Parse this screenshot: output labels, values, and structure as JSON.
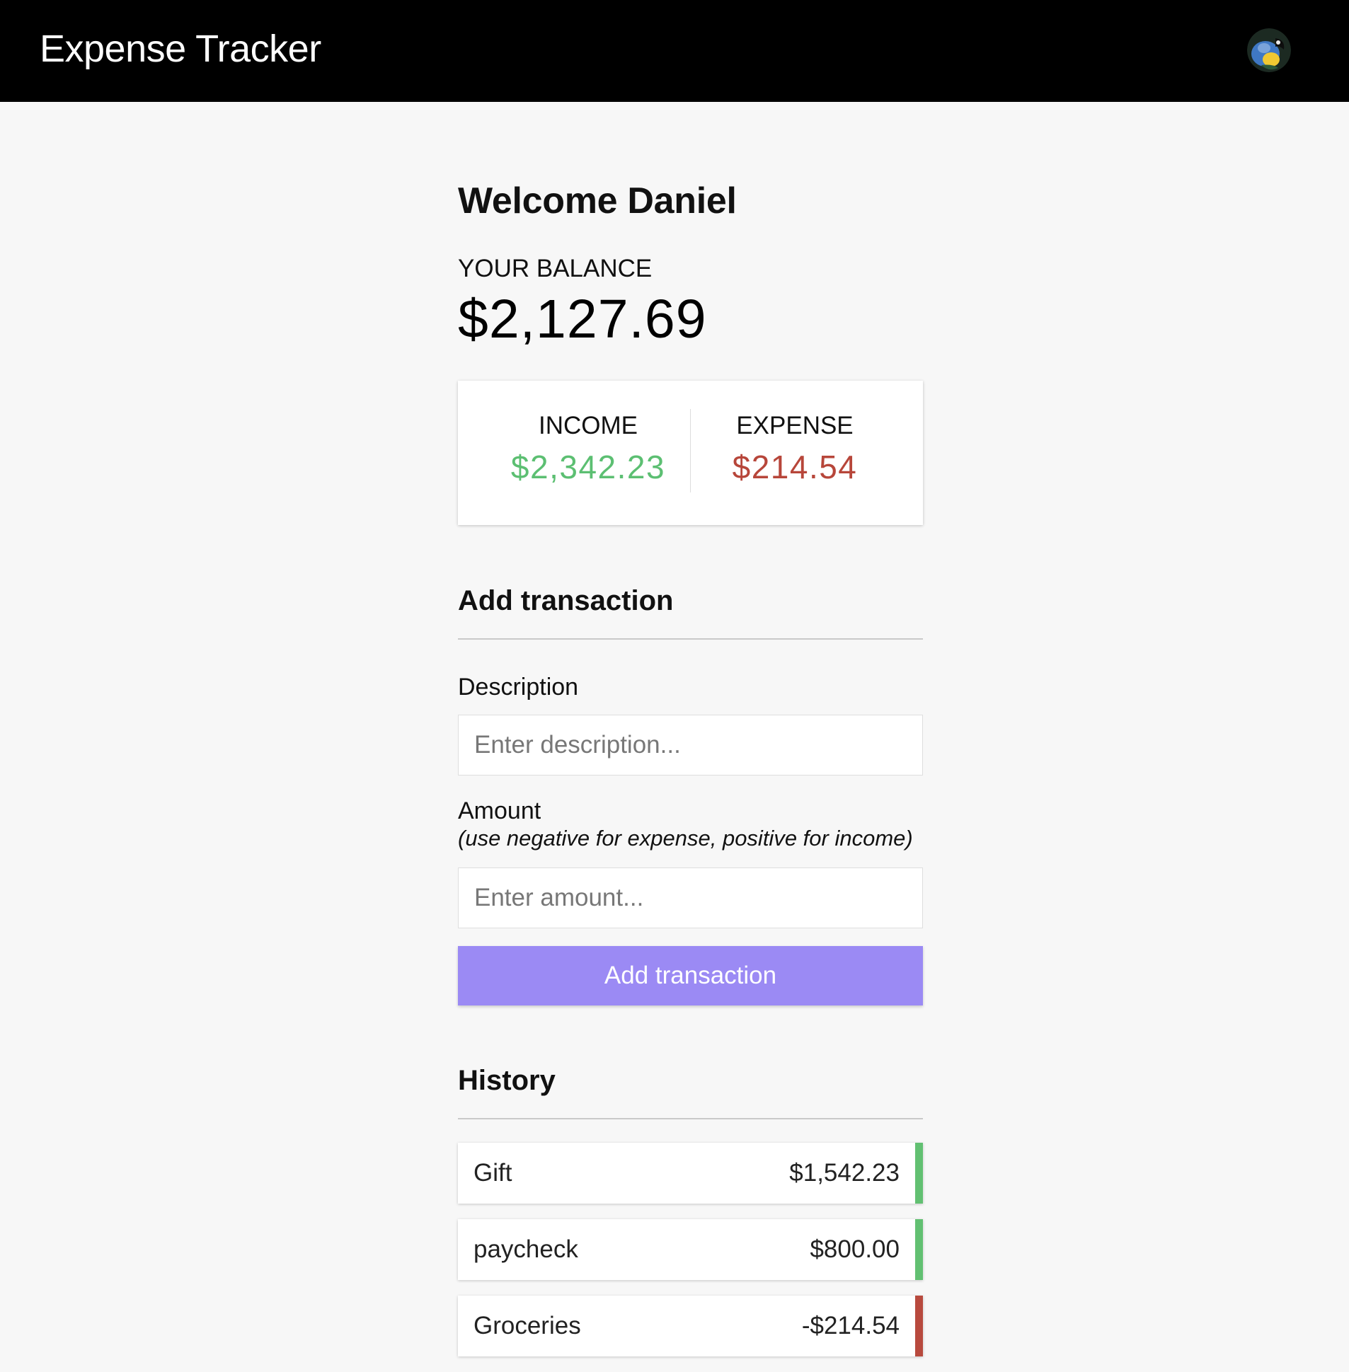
{
  "header": {
    "title": "Expense Tracker",
    "avatar_icon": "parrot-avatar-icon"
  },
  "welcome": "Welcome Daniel",
  "balance": {
    "label": "YOUR BALANCE",
    "value": "$2,127.69"
  },
  "summary": {
    "income_label": "INCOME",
    "income_value": "$2,342.23",
    "expense_label": "EXPENSE",
    "expense_value": "$214.54"
  },
  "add_transaction": {
    "title": "Add transaction",
    "description_label": "Description",
    "description_placeholder": "Enter description...",
    "description_value": "",
    "amount_label": "Amount",
    "amount_hint": "(use negative for expense, positive for income)",
    "amount_placeholder": "Enter amount...",
    "amount_value": "",
    "button_label": "Add transaction"
  },
  "history": {
    "title": "History",
    "items": [
      {
        "description": "Gift",
        "amount": "$1,542.23",
        "type": "income"
      },
      {
        "description": "paycheck",
        "amount": "$800.00",
        "type": "income"
      },
      {
        "description": "Groceries",
        "amount": "-$214.54",
        "type": "expense"
      }
    ]
  },
  "colors": {
    "header_bg": "#000000",
    "page_bg": "#f7f7f7",
    "income": "#5cbf72",
    "expense": "#b7463a",
    "button": "#9b8af4",
    "income_stripe": "#62c072",
    "expense_stripe": "#b84a3e"
  }
}
